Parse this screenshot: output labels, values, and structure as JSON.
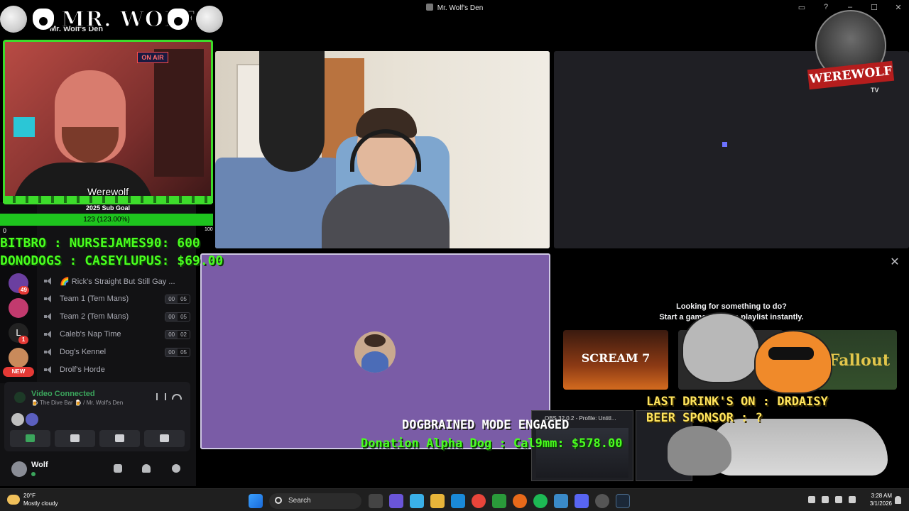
{
  "window": {
    "title": "Mr. Wolf's Den",
    "server_name": "Mr. Wolf's Den"
  },
  "overlay": {
    "logo_text": "MR. WOLF",
    "cam_label": "Werewolf",
    "subgoal_title": "2025 Sub Goal",
    "subgoal_value": "123 (123.00%)",
    "subgoal_progress": 1.0,
    "subgoal_min": "0",
    "subgoal_max": "100",
    "ticker_line1": "BITBRO : NURSEJAMES90: 600",
    "ticker_line2": "DONODOGS : CASEYLUPUS: $69.00",
    "dogbrained": "DOGBRAINED MODE ENGAGED",
    "donation": "Donation Alpha Dog : Cal9mm: $578.00",
    "last_drink": "LAST DRINK'S ON : DRDAISY",
    "beer_sponsor": "BEER SPONSOR : ?",
    "werewolf_tv": "WEREWOLF",
    "werewolf_tv_sub": "TV",
    "onair": "ON AIR"
  },
  "servers": {
    "badges": [
      "49",
      "1"
    ],
    "letter": "L",
    "new_label": "NEW"
  },
  "channels": [
    {
      "name": "🌈 Rick's Straight But Still Gay ...",
      "count": null
    },
    {
      "name": "Team 1 (Tem Mans)",
      "count": [
        "00",
        "05"
      ]
    },
    {
      "name": "Team 2 (Tem Mans)",
      "count": [
        "00",
        "05"
      ]
    },
    {
      "name": "Caleb's Nap Time",
      "count": [
        "00",
        "02"
      ]
    },
    {
      "name": "Dog's Kennel",
      "count": [
        "00",
        "05"
      ]
    },
    {
      "name": "Drolf's Horde",
      "count": null
    }
  ],
  "voice": {
    "status": "Video Connected",
    "location": "🍺 The Dive Bar 🍺 / Mr. Wolf's Den"
  },
  "user": {
    "name": "Wolf"
  },
  "activity": {
    "title_line1": "Looking for something to do?",
    "title_line2": "Start a game or video playlist instantly.",
    "games": [
      "SCREAM 7",
      "",
      "Fallout"
    ],
    "close": "✕"
  },
  "obs": {
    "title": "OBS 32.0.2 - Profile: Untitl..."
  },
  "taskbar": {
    "temp": "20°F",
    "condition": "Mostly cloudy",
    "search": "Search",
    "time": "3:28 AM",
    "date": "3/1/2026"
  },
  "colors": {
    "neon_green": "#49ff1e",
    "accent_green": "#3ba55c",
    "tile_purple": "#7a5ca6",
    "alert_red": "#e53935"
  }
}
